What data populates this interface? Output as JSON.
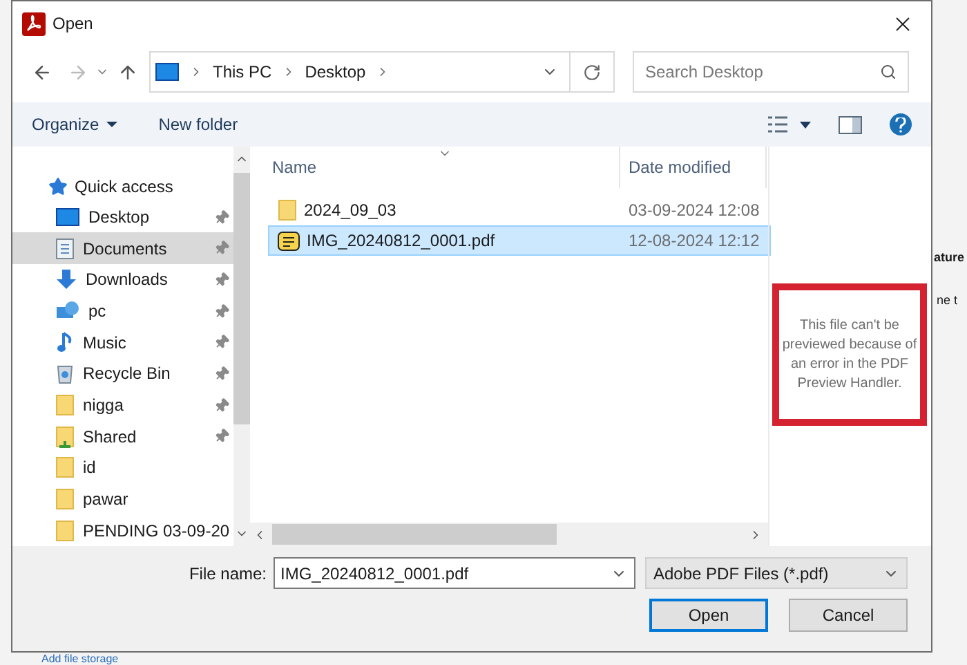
{
  "window": {
    "title": "Open"
  },
  "address": {
    "crumbs": [
      "This PC",
      "Desktop"
    ]
  },
  "search": {
    "placeholder": "Search Desktop"
  },
  "toolbar": {
    "organize": "Organize",
    "new_folder": "New folder"
  },
  "sidebar": {
    "header": "Quick access",
    "items": [
      {
        "label": "Desktop",
        "kind": "desktop",
        "pinned": true,
        "selected": false
      },
      {
        "label": "Documents",
        "kind": "documents",
        "pinned": true,
        "selected": true
      },
      {
        "label": "Downloads",
        "kind": "downloads",
        "pinned": true,
        "selected": false
      },
      {
        "label": "pc",
        "kind": "pc",
        "pinned": true,
        "selected": false
      },
      {
        "label": "Music",
        "kind": "music",
        "pinned": true,
        "selected": false
      },
      {
        "label": "Recycle Bin",
        "kind": "recycle",
        "pinned": true,
        "selected": false
      },
      {
        "label": "nigga",
        "kind": "folder",
        "pinned": true,
        "selected": false
      },
      {
        "label": "Shared",
        "kind": "shared",
        "pinned": true,
        "selected": false
      },
      {
        "label": "id",
        "kind": "folder",
        "pinned": false,
        "selected": false
      },
      {
        "label": "pawar",
        "kind": "folder",
        "pinned": false,
        "selected": false
      },
      {
        "label": "PENDING 03-09-20",
        "kind": "folder",
        "pinned": false,
        "selected": false
      }
    ]
  },
  "table": {
    "columns": [
      "Name",
      "Date modified"
    ],
    "rows": [
      {
        "name": "2024_09_03",
        "date": "03-09-2024 12:08",
        "kind": "folder",
        "selected": false
      },
      {
        "name": "IMG_20240812_0001.pdf",
        "date": "12-08-2024 12:12",
        "kind": "pdf",
        "selected": true
      }
    ]
  },
  "preview": {
    "message": "This file can't be previewed because of an error in the PDF Preview Handler."
  },
  "footer": {
    "file_name_label": "File name:",
    "file_name": "IMG_20240812_0001.pdf",
    "file_type": "Adobe PDF Files (*.pdf)",
    "buttons": [
      "Open",
      "Cancel"
    ]
  },
  "background": {
    "texts": [
      "ature",
      "ne t"
    ],
    "link": "Add file storage"
  }
}
